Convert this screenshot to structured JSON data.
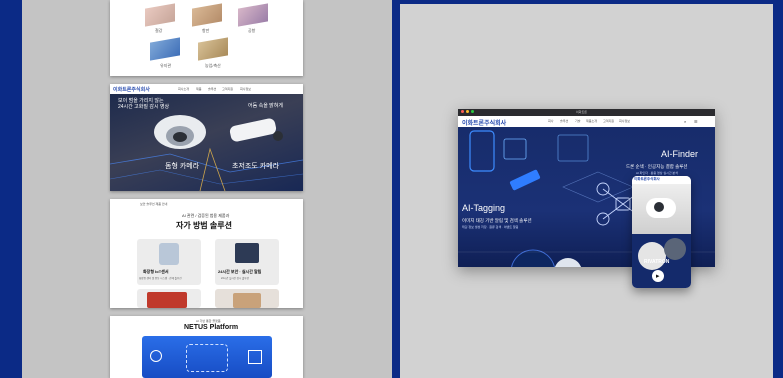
{
  "thumb1": {
    "labels": [
      "철강",
      "항만",
      "공항",
      "유지관",
      "농업/축산"
    ]
  },
  "thumb2": {
    "logo": "이화트론주식회사",
    "nav": [
      "회사소개",
      "제품",
      "솔루션",
      "고객지원",
      "회사정보"
    ],
    "headline1": "보이 범을 가리지 않는",
    "headline2": "24시간 고화질 감시 영상",
    "headline3": "어둠 속을 밝혀게",
    "label_left": "돔형 카메라",
    "label_right": "초저조도 카메라"
  },
  "thumb3": {
    "tag": "보안 솔루션 제품 안내",
    "title_small": "AI 관련 / 검증된 범용 제품과",
    "title_large": "자가 방범 솔루션",
    "card1_title": "화장형 IoT센서",
    "card1_sub": "화장형 센서 및 연동 시스템 · 관제 솔루션",
    "card2_title": "24시간 보안 · 실시간 알림",
    "card2_sub": "24시간 실시간 감시 솔루션"
  },
  "thumb4": {
    "small": "AI 기반 통합 플랫폼",
    "title": "NETUS Platform"
  },
  "mockup": {
    "window_title": "이화트론",
    "logo": "이화트론주식회사",
    "nav": [
      "회사",
      "솔루션",
      "기술",
      "제품소개",
      "고객지원",
      "회사정보"
    ],
    "finder_title": "AI-Finder",
    "finder_line1": "드론 순색 · 인공지능 결합 솔루션",
    "finder_line2": "AI 파인더 · 활용 영상 실시간 분석",
    "tagging_title": "AI-Tagging",
    "tagging_line1": "이미지 태깅 기반 알림 및 검색 솔루션",
    "tagging_line2": "태깅 정보 생성 저장 · 원류 검색 · 이벤트 알림",
    "phone_brand": "RIVATRON",
    "phone_logo": "이화트론주식회사"
  },
  "colors": {
    "frame": "#0b2a86",
    "panel_left": "#c4c4c4",
    "panel_right": "#d2d2d2",
    "hero": "#142a6b",
    "accent": "#1e5bd6",
    "brand_orange": "#e8652a"
  }
}
